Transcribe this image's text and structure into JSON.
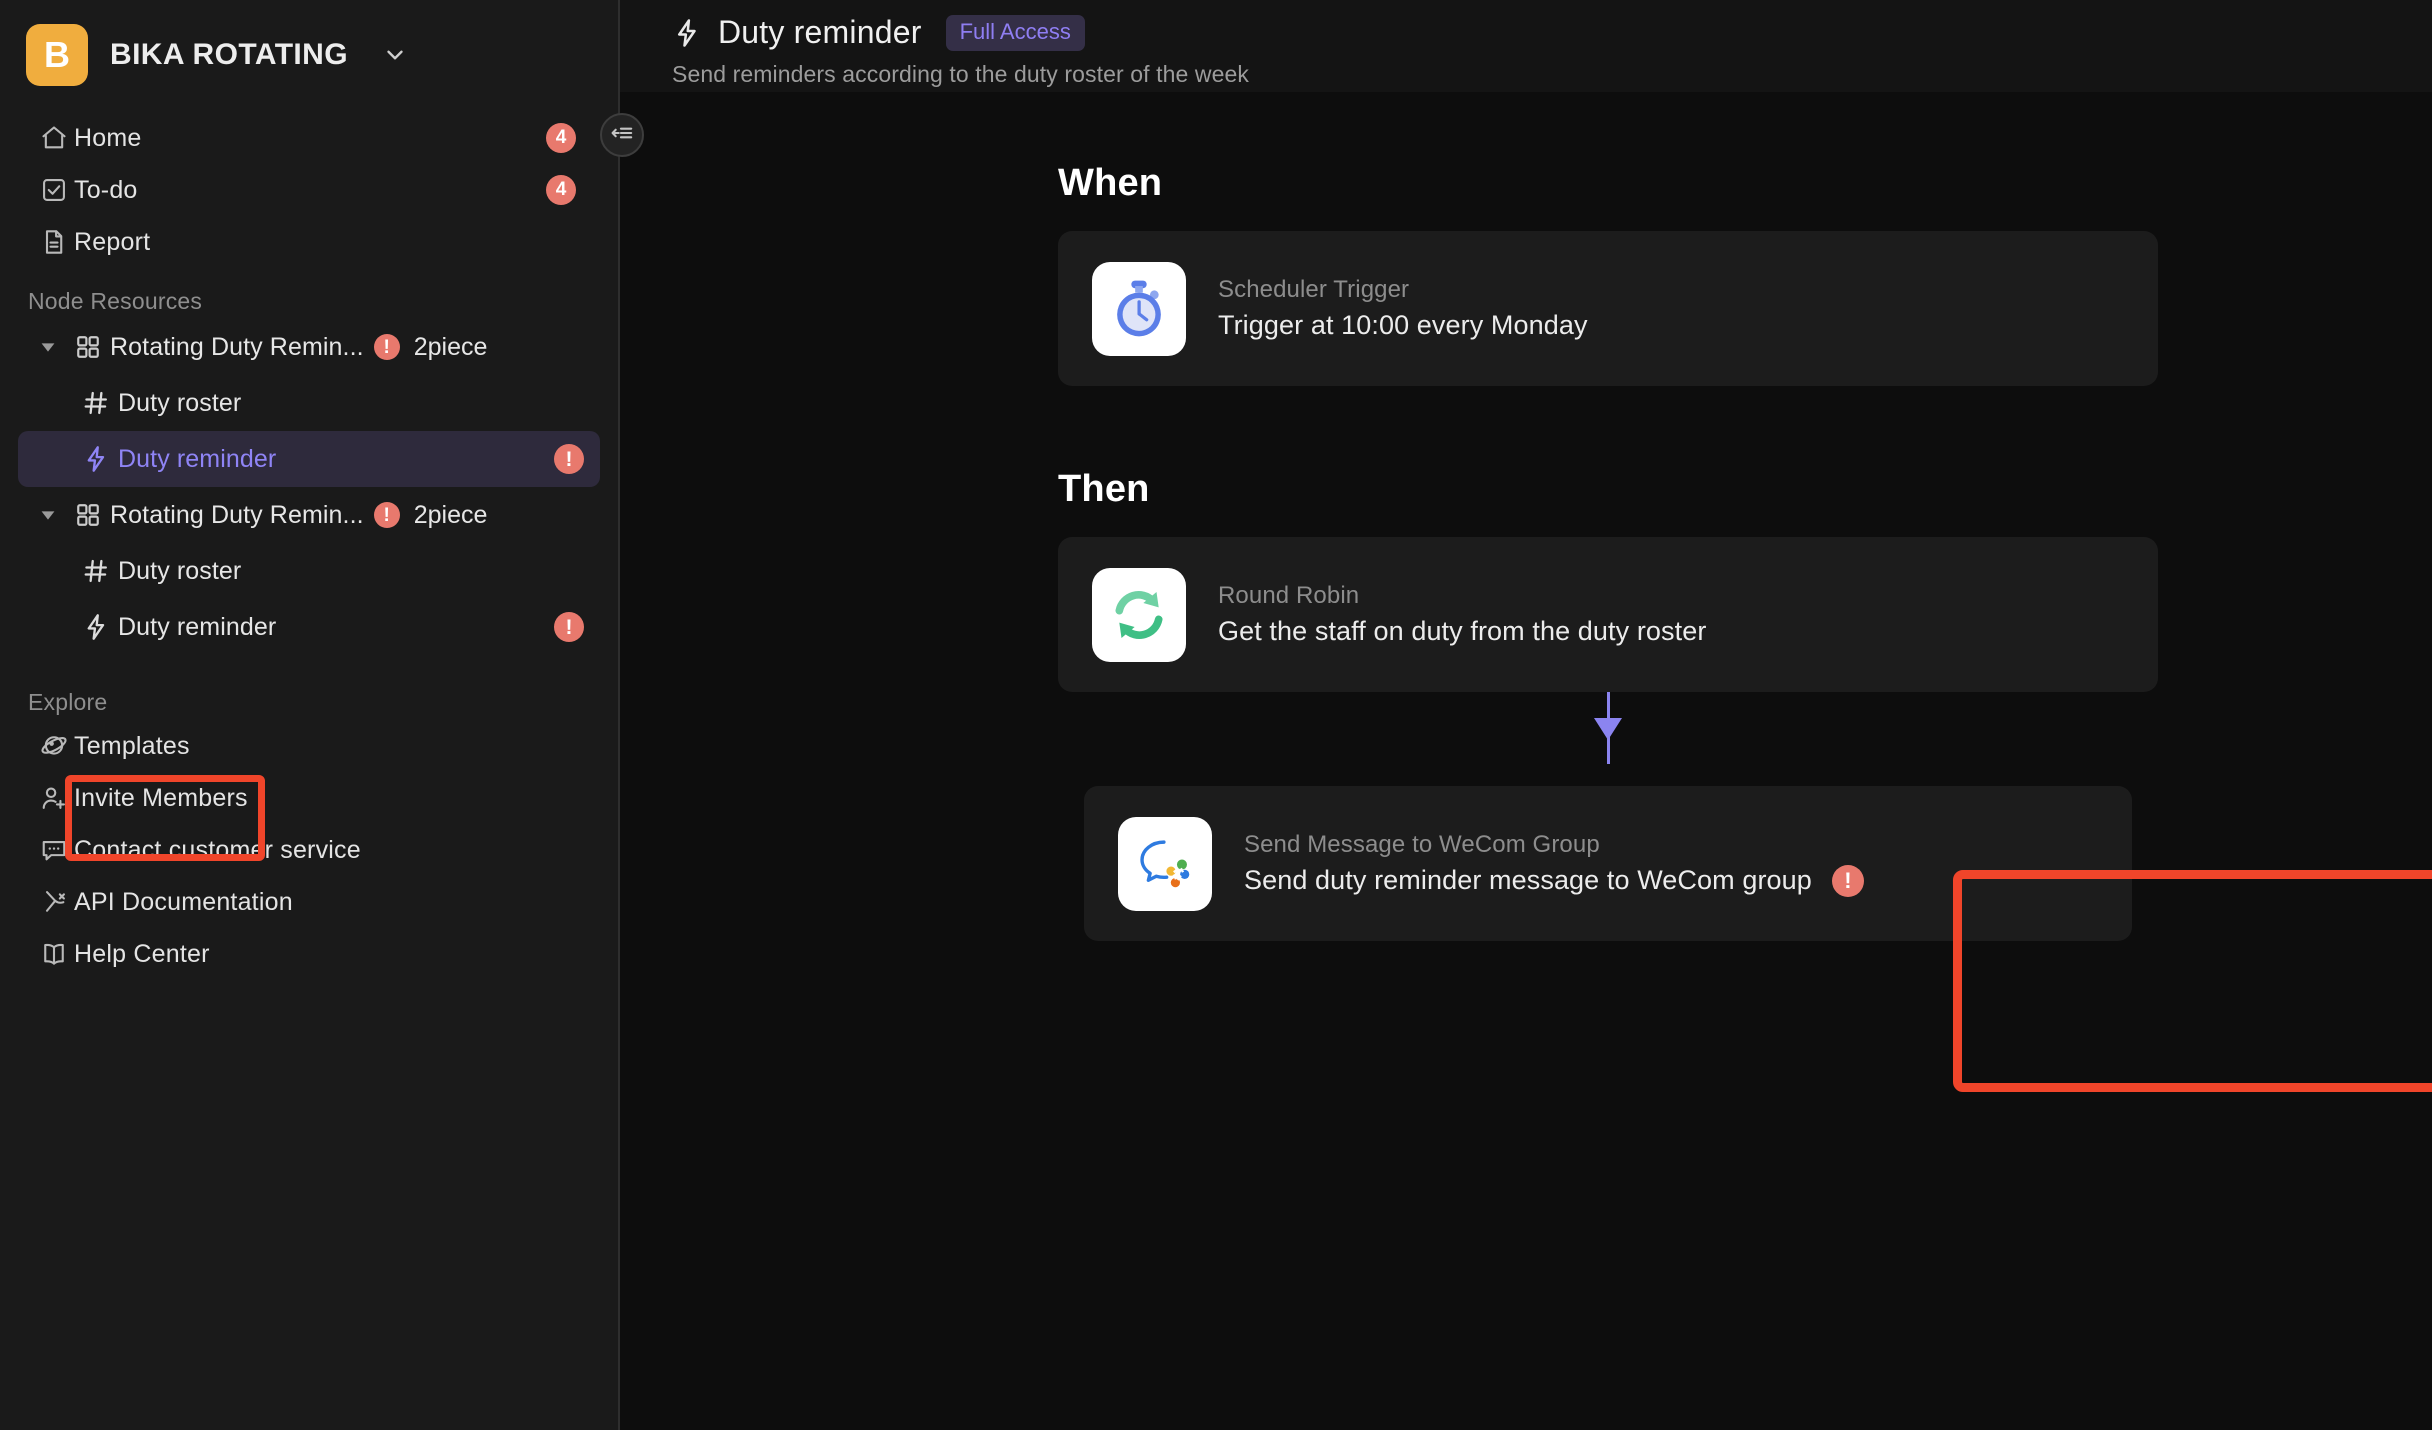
{
  "workspace": {
    "logo_letter": "B",
    "name": "BIKA ROTATING",
    "logo_color": "#f0ad3e",
    "chevron_icon": "chevron-down-icon"
  },
  "sidebar": {
    "nav": [
      {
        "label": "Home",
        "icon": "home-icon",
        "badge": "4"
      },
      {
        "label": "To-do",
        "icon": "checkbox-icon",
        "badge": "4"
      },
      {
        "label": "Report",
        "icon": "document-icon",
        "badge": ""
      }
    ],
    "node_resources_title": "Node Resources",
    "tree": [
      {
        "label": "Rotating Duty Remin...",
        "icon": "grid-icon",
        "caret": "caret-down-icon",
        "warn": "!",
        "meta": "2piece",
        "level": "parent",
        "selected": false
      },
      {
        "label": "Duty roster",
        "icon": "hash-icon",
        "caret": "",
        "warn": "",
        "meta": "",
        "level": "child",
        "selected": false
      },
      {
        "label": "Duty reminder",
        "icon": "lightning-icon",
        "caret": "",
        "warn": "!",
        "meta": "",
        "level": "child",
        "selected": true
      },
      {
        "label": "Rotating Duty Remin...",
        "icon": "grid-icon",
        "caret": "caret-down-icon",
        "warn": "!",
        "meta": "2piece",
        "level": "parent",
        "selected": false
      },
      {
        "label": "Duty roster",
        "icon": "hash-icon",
        "caret": "",
        "warn": "",
        "meta": "",
        "level": "child",
        "selected": false
      },
      {
        "label": "Duty reminder",
        "icon": "lightning-icon",
        "caret": "",
        "warn": "!",
        "meta": "",
        "level": "child",
        "selected": false
      }
    ],
    "explore_title": "Explore",
    "explore": [
      {
        "label": "Templates",
        "icon": "planet-icon"
      },
      {
        "label": "Invite Members",
        "icon": "user-plus-icon"
      },
      {
        "label": "Contact customer service",
        "icon": "chat-icon"
      },
      {
        "label": "API Documentation",
        "icon": "api-plug-icon"
      },
      {
        "label": "Help Center",
        "icon": "book-icon"
      }
    ],
    "collapse_button_icon": "collapse-sidebar-icon"
  },
  "header": {
    "icon": "lightning-icon",
    "title": "Duty reminder",
    "access_badge": "Full Access",
    "subtitle": "Send reminders according to the duty roster of the week"
  },
  "automation": {
    "when_heading": "When",
    "then_heading": "Then",
    "trigger": {
      "kind": "Scheduler Trigger",
      "description": "Trigger at 10:00 every Monday",
      "icon": "stopwatch-icon",
      "warn": ""
    },
    "actions": [
      {
        "kind": "Round Robin",
        "description": "Get the staff on duty from the duty roster",
        "icon": "refresh-cycle-icon",
        "warn": ""
      },
      {
        "kind": "Send Message to WeCom Group",
        "description": "Send duty reminder message to WeCom group",
        "icon": "wecom-icon",
        "warn": "!"
      }
    ]
  },
  "colors": {
    "accent_purple": "#8f84f5",
    "annotation_red": "#f0452a",
    "error_badge": "#e8796d",
    "sidebar_bg": "#1a1a1a",
    "main_bg": "#0d0d0d"
  }
}
